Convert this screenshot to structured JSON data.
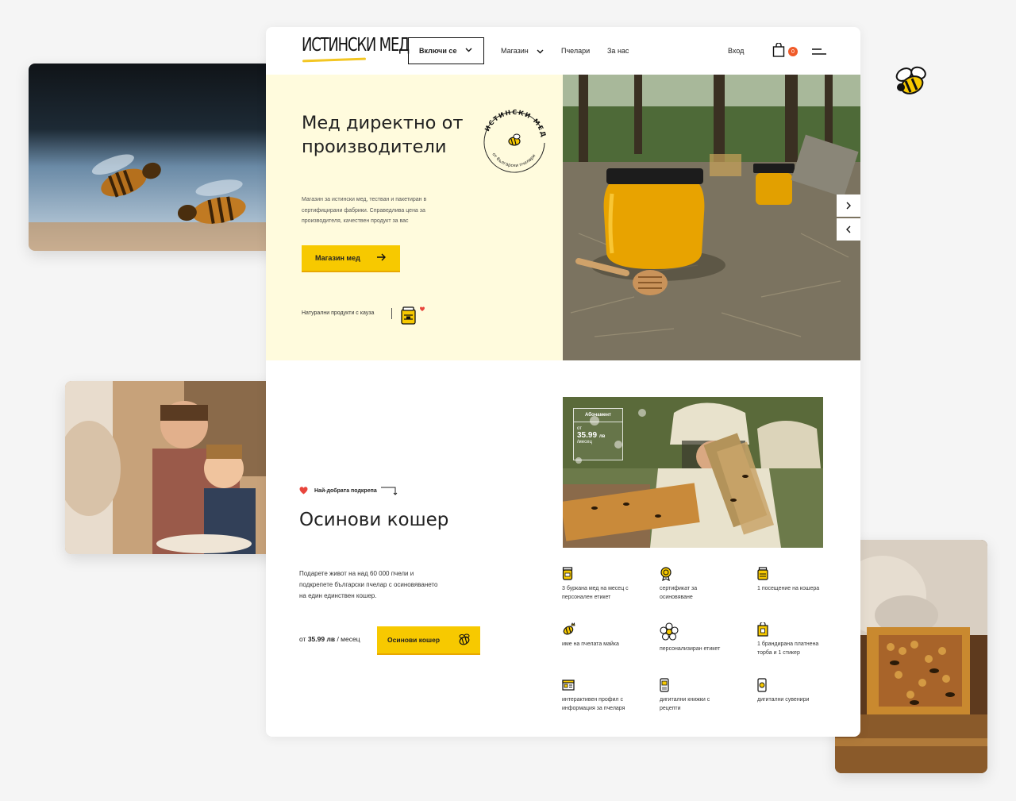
{
  "header": {
    "logo": "ИСТИНСКИ МЕД",
    "join_label": "Включи се",
    "nav": {
      "shop": "Магазин",
      "beekeepers": "Пчелари",
      "about": "За нас",
      "login": "Вход"
    },
    "cart_count": "0"
  },
  "hero": {
    "title": "Мед директно от производители",
    "description": "Магазин за истински мед, тестван и пакетиран в сертифицирани фабрики. Справедлива цена за производителя, качествен продукт за вас",
    "cta": "Магазин мед",
    "cause": "Натурални продукти с кауза",
    "badge_top": "ИСТИНСКИ МЕД",
    "badge_bottom": "от български пчелари"
  },
  "adopt": {
    "support_label": "Най-добрата подкрепа",
    "title": "Осинови кошер",
    "description": "Подарете живот на над 60 000 пчели и подкрепете български пчелар с осиновяването на един единствен кошер.",
    "price_prefix": "от",
    "price": "35.99 лв",
    "price_suffix": " / месец",
    "cta": "Осинови кошер",
    "subscription": {
      "label": "Абонамент",
      "from": "от",
      "price": "35.99",
      "currency": "лв",
      "period": "/месец"
    },
    "features": [
      {
        "icon": "jar-icon",
        "text": "3 буркана мед на месец с персонален етикет"
      },
      {
        "icon": "certificate-icon",
        "text": "сертификат за осиновяване"
      },
      {
        "icon": "hive-visit-icon",
        "text": "1 посещение на кошера"
      },
      {
        "icon": "queen-bee-icon",
        "text": "име на пчелата майка"
      },
      {
        "icon": "flower-label-icon",
        "text": "персонализиран етикет"
      },
      {
        "icon": "bag-icon",
        "text": "1 брандирана платнена торба и 1 стикер"
      },
      {
        "icon": "profile-icon",
        "text": "интерактивен профил с информация за пчеларя"
      },
      {
        "icon": "recipe-book-icon",
        "text": "дигитални книжки с рецепти"
      },
      {
        "icon": "souvenir-icon",
        "text": "дигитални сувенири"
      }
    ]
  },
  "colors": {
    "accent": "#f7c900",
    "hero_bg": "#fffbdd",
    "badge": "#f05a28",
    "heart": "#e8453c"
  }
}
